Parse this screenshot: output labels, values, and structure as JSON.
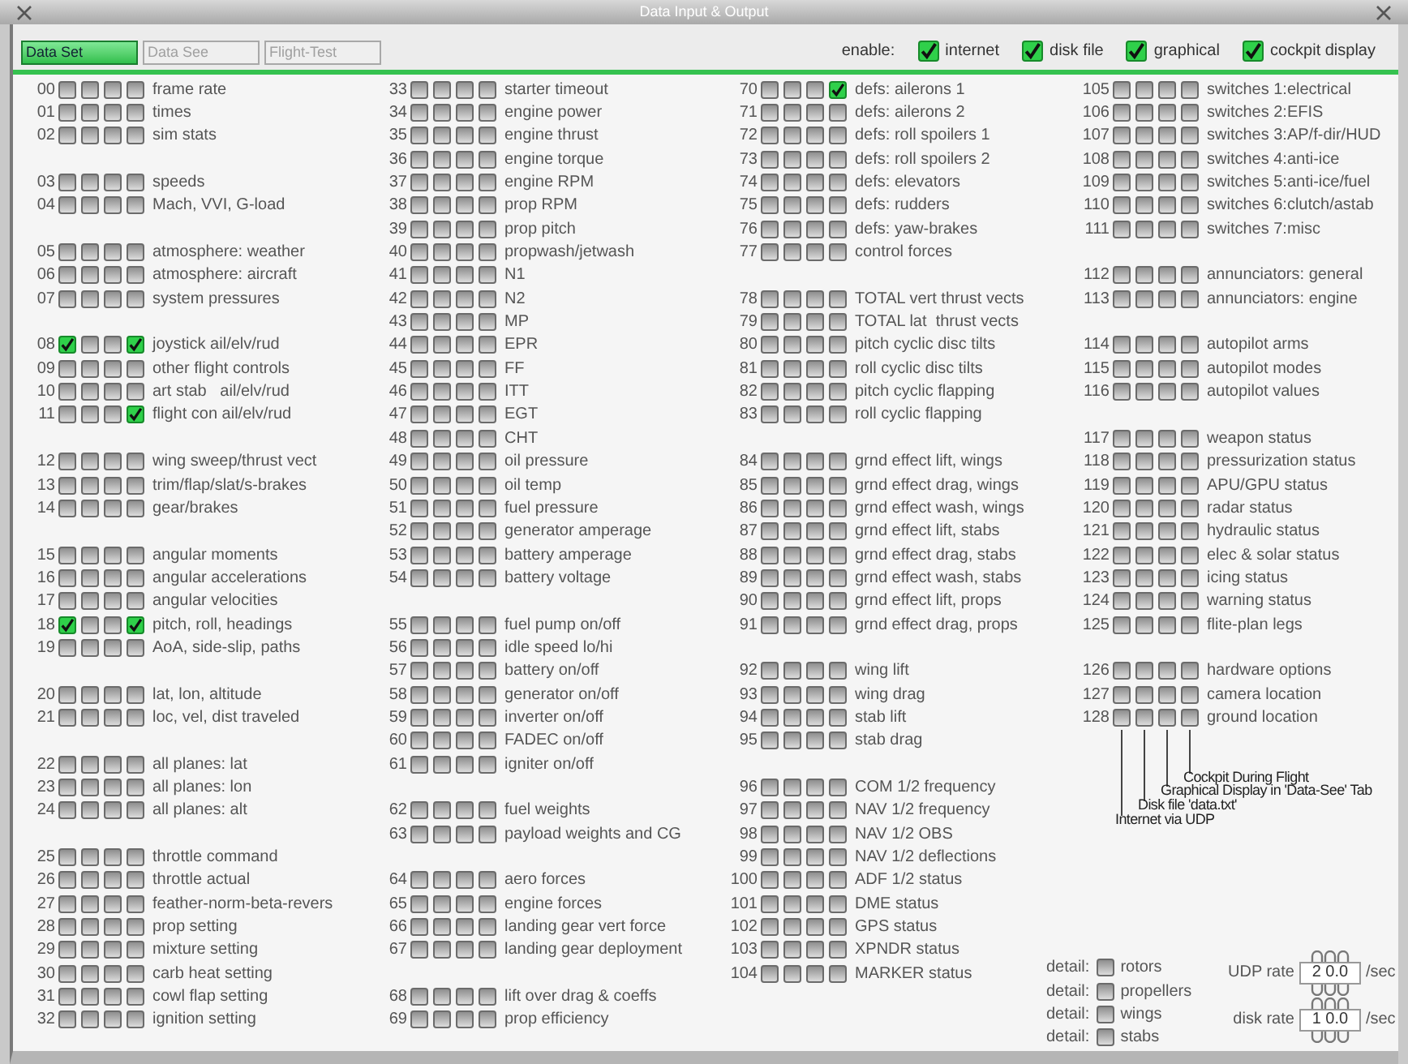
{
  "window": {
    "title": "Data Input & Output"
  },
  "tabs": [
    {
      "label": "Data Set",
      "selected": true
    },
    {
      "label": "Data See",
      "selected": false
    },
    {
      "label": "Flight-Test",
      "selected": false
    }
  ],
  "enable": {
    "label": "enable:",
    "options": [
      {
        "label": "internet",
        "checked": true
      },
      {
        "label": "disk file",
        "checked": true
      },
      {
        "label": "graphical",
        "checked": true
      },
      {
        "label": "cockpit display",
        "checked": true
      }
    ]
  },
  "columns": [
    {
      "groups": [
        [
          {
            "number": "00",
            "label": "frame rate",
            "checks": [
              false,
              false,
              false,
              false
            ]
          },
          {
            "number": "01",
            "label": "times",
            "checks": [
              false,
              false,
              false,
              false
            ]
          },
          {
            "number": "02",
            "label": "sim stats",
            "checks": [
              false,
              false,
              false,
              false
            ]
          }
        ],
        [
          {
            "number": "03",
            "label": "speeds",
            "checks": [
              false,
              false,
              false,
              false
            ]
          },
          {
            "number": "04",
            "label": "Mach, VVI, G-load",
            "checks": [
              false,
              false,
              false,
              false
            ]
          }
        ],
        [
          {
            "number": "05",
            "label": "atmosphere: weather",
            "checks": [
              false,
              false,
              false,
              false
            ]
          },
          {
            "number": "06",
            "label": "atmosphere: aircraft",
            "checks": [
              false,
              false,
              false,
              false
            ]
          },
          {
            "number": "07",
            "label": "system pressures",
            "checks": [
              false,
              false,
              false,
              false
            ]
          }
        ],
        [
          {
            "number": "08",
            "label": "joystick ail/elv/rud",
            "checks": [
              true,
              false,
              false,
              true
            ]
          },
          {
            "number": "09",
            "label": "other flight controls",
            "checks": [
              false,
              false,
              false,
              false
            ]
          },
          {
            "number": "10",
            "label": "art stab   ail/elv/rud",
            "checks": [
              false,
              false,
              false,
              false
            ]
          },
          {
            "number": "11",
            "label": "flight con ail/elv/rud",
            "checks": [
              false,
              false,
              false,
              true
            ]
          }
        ],
        [
          {
            "number": "12",
            "label": "wing sweep/thrust vect",
            "checks": [
              false,
              false,
              false,
              false
            ]
          },
          {
            "number": "13",
            "label": "trim/flap/slat/s-brakes",
            "checks": [
              false,
              false,
              false,
              false
            ]
          },
          {
            "number": "14",
            "label": "gear/brakes",
            "checks": [
              false,
              false,
              false,
              false
            ]
          }
        ],
        [
          {
            "number": "15",
            "label": "angular moments",
            "checks": [
              false,
              false,
              false,
              false
            ]
          },
          {
            "number": "16",
            "label": "angular accelerations",
            "checks": [
              false,
              false,
              false,
              false
            ]
          },
          {
            "number": "17",
            "label": "angular velocities",
            "checks": [
              false,
              false,
              false,
              false
            ]
          },
          {
            "number": "18",
            "label": "pitch, roll, headings",
            "checks": [
              true,
              false,
              false,
              true
            ]
          },
          {
            "number": "19",
            "label": "AoA, side-slip, paths",
            "checks": [
              false,
              false,
              false,
              false
            ]
          }
        ],
        [
          {
            "number": "20",
            "label": "lat, lon, altitude",
            "checks": [
              false,
              false,
              false,
              false
            ]
          },
          {
            "number": "21",
            "label": "loc, vel, dist traveled",
            "checks": [
              false,
              false,
              false,
              false
            ]
          }
        ],
        [
          {
            "number": "22",
            "label": "all planes: lat",
            "checks": [
              false,
              false,
              false,
              false
            ]
          },
          {
            "number": "23",
            "label": "all planes: lon",
            "checks": [
              false,
              false,
              false,
              false
            ]
          },
          {
            "number": "24",
            "label": "all planes: alt",
            "checks": [
              false,
              false,
              false,
              false
            ]
          }
        ],
        [
          {
            "number": "25",
            "label": "throttle command",
            "checks": [
              false,
              false,
              false,
              false
            ]
          },
          {
            "number": "26",
            "label": "throttle actual",
            "checks": [
              false,
              false,
              false,
              false
            ]
          },
          {
            "number": "27",
            "label": "feather-norm-beta-revers",
            "checks": [
              false,
              false,
              false,
              false
            ]
          },
          {
            "number": "28",
            "label": "prop setting",
            "checks": [
              false,
              false,
              false,
              false
            ]
          },
          {
            "number": "29",
            "label": "mixture setting",
            "checks": [
              false,
              false,
              false,
              false
            ]
          },
          {
            "number": "30",
            "label": "carb heat setting",
            "checks": [
              false,
              false,
              false,
              false
            ]
          },
          {
            "number": "31",
            "label": "cowl flap setting",
            "checks": [
              false,
              false,
              false,
              false
            ]
          },
          {
            "number": "32",
            "label": "ignition setting",
            "checks": [
              false,
              false,
              false,
              false
            ]
          }
        ]
      ]
    },
    {
      "groups": [
        [
          {
            "number": "33",
            "label": "starter timeout",
            "checks": [
              false,
              false,
              false,
              false
            ]
          },
          {
            "number": "34",
            "label": "engine power",
            "checks": [
              false,
              false,
              false,
              false
            ]
          },
          {
            "number": "35",
            "label": "engine thrust",
            "checks": [
              false,
              false,
              false,
              false
            ]
          },
          {
            "number": "36",
            "label": "engine torque",
            "checks": [
              false,
              false,
              false,
              false
            ]
          },
          {
            "number": "37",
            "label": "engine RPM",
            "checks": [
              false,
              false,
              false,
              false
            ]
          },
          {
            "number": "38",
            "label": "prop RPM",
            "checks": [
              false,
              false,
              false,
              false
            ]
          },
          {
            "number": "39",
            "label": "prop pitch",
            "checks": [
              false,
              false,
              false,
              false
            ]
          },
          {
            "number": "40",
            "label": "propwash/jetwash",
            "checks": [
              false,
              false,
              false,
              false
            ]
          },
          {
            "number": "41",
            "label": "N1",
            "checks": [
              false,
              false,
              false,
              false
            ]
          },
          {
            "number": "42",
            "label": "N2",
            "checks": [
              false,
              false,
              false,
              false
            ]
          },
          {
            "number": "43",
            "label": "MP",
            "checks": [
              false,
              false,
              false,
              false
            ]
          },
          {
            "number": "44",
            "label": "EPR",
            "checks": [
              false,
              false,
              false,
              false
            ]
          },
          {
            "number": "45",
            "label": "FF",
            "checks": [
              false,
              false,
              false,
              false
            ]
          },
          {
            "number": "46",
            "label": "ITT",
            "checks": [
              false,
              false,
              false,
              false
            ]
          },
          {
            "number": "47",
            "label": "EGT",
            "checks": [
              false,
              false,
              false,
              false
            ]
          },
          {
            "number": "48",
            "label": "CHT",
            "checks": [
              false,
              false,
              false,
              false
            ]
          },
          {
            "number": "49",
            "label": "oil pressure",
            "checks": [
              false,
              false,
              false,
              false
            ]
          },
          {
            "number": "50",
            "label": "oil temp",
            "checks": [
              false,
              false,
              false,
              false
            ]
          },
          {
            "number": "51",
            "label": "fuel pressure",
            "checks": [
              false,
              false,
              false,
              false
            ]
          },
          {
            "number": "52",
            "label": "generator amperage",
            "checks": [
              false,
              false,
              false,
              false
            ]
          },
          {
            "number": "53",
            "label": "battery amperage",
            "checks": [
              false,
              false,
              false,
              false
            ]
          },
          {
            "number": "54",
            "label": "battery voltage",
            "checks": [
              false,
              false,
              false,
              false
            ]
          }
        ],
        [
          {
            "number": "55",
            "label": "fuel pump on/off",
            "checks": [
              false,
              false,
              false,
              false
            ]
          },
          {
            "number": "56",
            "label": "idle speed lo/hi",
            "checks": [
              false,
              false,
              false,
              false
            ]
          },
          {
            "number": "57",
            "label": "battery on/off",
            "checks": [
              false,
              false,
              false,
              false
            ]
          },
          {
            "number": "58",
            "label": "generator on/off",
            "checks": [
              false,
              false,
              false,
              false
            ]
          },
          {
            "number": "59",
            "label": "inverter on/off",
            "checks": [
              false,
              false,
              false,
              false
            ]
          },
          {
            "number": "60",
            "label": "FADEC on/off",
            "checks": [
              false,
              false,
              false,
              false
            ]
          },
          {
            "number": "61",
            "label": "igniter on/off",
            "checks": [
              false,
              false,
              false,
              false
            ]
          }
        ],
        [
          {
            "number": "62",
            "label": "fuel weights",
            "checks": [
              false,
              false,
              false,
              false
            ]
          },
          {
            "number": "63",
            "label": "payload weights and CG",
            "checks": [
              false,
              false,
              false,
              false
            ]
          }
        ],
        [
          {
            "number": "64",
            "label": "aero forces",
            "checks": [
              false,
              false,
              false,
              false
            ]
          },
          {
            "number": "65",
            "label": "engine forces",
            "checks": [
              false,
              false,
              false,
              false
            ]
          },
          {
            "number": "66",
            "label": "landing gear vert force",
            "checks": [
              false,
              false,
              false,
              false
            ]
          },
          {
            "number": "67",
            "label": "landing gear deployment",
            "checks": [
              false,
              false,
              false,
              false
            ]
          }
        ],
        [
          {
            "number": "68",
            "label": "lift over drag & coeffs",
            "checks": [
              false,
              false,
              false,
              false
            ]
          },
          {
            "number": "69",
            "label": "prop efficiency",
            "checks": [
              false,
              false,
              false,
              false
            ]
          }
        ]
      ]
    },
    {
      "groups": [
        [
          {
            "number": "70",
            "label": "defs: ailerons 1",
            "checks": [
              false,
              false,
              false,
              true
            ]
          },
          {
            "number": "71",
            "label": "defs: ailerons 2",
            "checks": [
              false,
              false,
              false,
              false
            ]
          },
          {
            "number": "72",
            "label": "defs: roll spoilers 1",
            "checks": [
              false,
              false,
              false,
              false
            ]
          },
          {
            "number": "73",
            "label": "defs: roll spoilers 2",
            "checks": [
              false,
              false,
              false,
              false
            ]
          },
          {
            "number": "74",
            "label": "defs: elevators",
            "checks": [
              false,
              false,
              false,
              false
            ]
          },
          {
            "number": "75",
            "label": "defs: rudders",
            "checks": [
              false,
              false,
              false,
              false
            ]
          },
          {
            "number": "76",
            "label": "defs: yaw-brakes",
            "checks": [
              false,
              false,
              false,
              false
            ]
          },
          {
            "number": "77",
            "label": "control forces",
            "checks": [
              false,
              false,
              false,
              false
            ]
          }
        ],
        [
          {
            "number": "78",
            "label": "TOTAL vert thrust vects",
            "checks": [
              false,
              false,
              false,
              false
            ]
          },
          {
            "number": "79",
            "label": "TOTAL lat  thrust vects",
            "checks": [
              false,
              false,
              false,
              false
            ]
          },
          {
            "number": "80",
            "label": "pitch cyclic disc tilts",
            "checks": [
              false,
              false,
              false,
              false
            ]
          },
          {
            "number": "81",
            "label": "roll cyclic disc tilts",
            "checks": [
              false,
              false,
              false,
              false
            ]
          },
          {
            "number": "82",
            "label": "pitch cyclic flapping",
            "checks": [
              false,
              false,
              false,
              false
            ]
          },
          {
            "number": "83",
            "label": "roll cyclic flapping",
            "checks": [
              false,
              false,
              false,
              false
            ]
          }
        ],
        [
          {
            "number": "84",
            "label": "grnd effect lift, wings",
            "checks": [
              false,
              false,
              false,
              false
            ]
          },
          {
            "number": "85",
            "label": "grnd effect drag, wings",
            "checks": [
              false,
              false,
              false,
              false
            ]
          },
          {
            "number": "86",
            "label": "grnd effect wash, wings",
            "checks": [
              false,
              false,
              false,
              false
            ]
          },
          {
            "number": "87",
            "label": "grnd effect lift, stabs",
            "checks": [
              false,
              false,
              false,
              false
            ]
          },
          {
            "number": "88",
            "label": "grnd effect drag, stabs",
            "checks": [
              false,
              false,
              false,
              false
            ]
          },
          {
            "number": "89",
            "label": "grnd effect wash, stabs",
            "checks": [
              false,
              false,
              false,
              false
            ]
          },
          {
            "number": "90",
            "label": "grnd effect lift, props",
            "checks": [
              false,
              false,
              false,
              false
            ]
          },
          {
            "number": "91",
            "label": "grnd effect drag, props",
            "checks": [
              false,
              false,
              false,
              false
            ]
          }
        ],
        [
          {
            "number": "92",
            "label": "wing lift",
            "checks": [
              false,
              false,
              false,
              false
            ]
          },
          {
            "number": "93",
            "label": "wing drag",
            "checks": [
              false,
              false,
              false,
              false
            ]
          },
          {
            "number": "94",
            "label": "stab lift",
            "checks": [
              false,
              false,
              false,
              false
            ]
          },
          {
            "number": "95",
            "label": "stab drag",
            "checks": [
              false,
              false,
              false,
              false
            ]
          }
        ],
        [
          {
            "number": "96",
            "label": "COM 1/2 frequency",
            "checks": [
              false,
              false,
              false,
              false
            ]
          },
          {
            "number": "97",
            "label": "NAV 1/2 frequency",
            "checks": [
              false,
              false,
              false,
              false
            ]
          },
          {
            "number": "98",
            "label": "NAV 1/2 OBS",
            "checks": [
              false,
              false,
              false,
              false
            ]
          },
          {
            "number": "99",
            "label": "NAV 1/2 deflections",
            "checks": [
              false,
              false,
              false,
              false
            ]
          },
          {
            "number": "100",
            "label": "ADF 1/2 status",
            "checks": [
              false,
              false,
              false,
              false
            ]
          },
          {
            "number": "101",
            "label": "DME status",
            "checks": [
              false,
              false,
              false,
              false
            ]
          },
          {
            "number": "102",
            "label": "GPS status",
            "checks": [
              false,
              false,
              false,
              false
            ]
          },
          {
            "number": "103",
            "label": "XPNDR status",
            "checks": [
              false,
              false,
              false,
              false
            ]
          },
          {
            "number": "104",
            "label": "MARKER status",
            "checks": [
              false,
              false,
              false,
              false
            ]
          }
        ]
      ]
    },
    {
      "groups": [
        [
          {
            "number": "105",
            "label": "switches 1:electrical",
            "checks": [
              false,
              false,
              false,
              false
            ]
          },
          {
            "number": "106",
            "label": "switches 2:EFIS",
            "checks": [
              false,
              false,
              false,
              false
            ]
          },
          {
            "number": "107",
            "label": "switches 3:AP/f-dir/HUD",
            "checks": [
              false,
              false,
              false,
              false
            ]
          },
          {
            "number": "108",
            "label": "switches 4:anti-ice",
            "checks": [
              false,
              false,
              false,
              false
            ]
          },
          {
            "number": "109",
            "label": "switches 5:anti-ice/fuel",
            "checks": [
              false,
              false,
              false,
              false
            ]
          },
          {
            "number": "110",
            "label": "switches 6:clutch/astab",
            "checks": [
              false,
              false,
              false,
              false
            ]
          },
          {
            "number": "111",
            "label": "switches 7:misc",
            "checks": [
              false,
              false,
              false,
              false
            ]
          }
        ],
        [
          {
            "number": "112",
            "label": "annunciators: general",
            "checks": [
              false,
              false,
              false,
              false
            ]
          },
          {
            "number": "113",
            "label": "annunciators: engine",
            "checks": [
              false,
              false,
              false,
              false
            ]
          }
        ],
        [
          {
            "number": "114",
            "label": "autopilot arms",
            "checks": [
              false,
              false,
              false,
              false
            ]
          },
          {
            "number": "115",
            "label": "autopilot modes",
            "checks": [
              false,
              false,
              false,
              false
            ]
          },
          {
            "number": "116",
            "label": "autopilot values",
            "checks": [
              false,
              false,
              false,
              false
            ]
          }
        ],
        [
          {
            "number": "117",
            "label": "weapon status",
            "checks": [
              false,
              false,
              false,
              false
            ]
          },
          {
            "number": "118",
            "label": "pressurization status",
            "checks": [
              false,
              false,
              false,
              false
            ]
          },
          {
            "number": "119",
            "label": "APU/GPU status",
            "checks": [
              false,
              false,
              false,
              false
            ]
          },
          {
            "number": "120",
            "label": "radar status",
            "checks": [
              false,
              false,
              false,
              false
            ]
          },
          {
            "number": "121",
            "label": "hydraulic status",
            "checks": [
              false,
              false,
              false,
              false
            ]
          },
          {
            "number": "122",
            "label": "elec & solar status",
            "checks": [
              false,
              false,
              false,
              false
            ]
          },
          {
            "number": "123",
            "label": "icing status",
            "checks": [
              false,
              false,
              false,
              false
            ]
          },
          {
            "number": "124",
            "label": "warning status",
            "checks": [
              false,
              false,
              false,
              false
            ]
          },
          {
            "number": "125",
            "label": "flite-plan legs",
            "checks": [
              false,
              false,
              false,
              false
            ]
          }
        ],
        [
          {
            "number": "126",
            "label": "hardware options",
            "checks": [
              false,
              false,
              false,
              false
            ]
          },
          {
            "number": "127",
            "label": "camera location",
            "checks": [
              false,
              false,
              false,
              false
            ]
          },
          {
            "number": "128",
            "label": "ground location",
            "checks": [
              false,
              false,
              false,
              false
            ]
          }
        ]
      ]
    }
  ],
  "legend": [
    "Cockpit During Flight",
    "Graphical Display in 'Data-See' Tab",
    "Disk file 'data.txt'",
    "Internet via UDP"
  ],
  "details": [
    {
      "label": "detail:",
      "name": "rotors",
      "checked": false
    },
    {
      "label": "detail:",
      "name": "propellers",
      "checked": false
    },
    {
      "label": "detail:",
      "name": "wings",
      "checked": false
    },
    {
      "label": "detail:",
      "name": "stabs",
      "checked": false
    }
  ],
  "rates": [
    {
      "label": "UDP rate",
      "value": "2 0.0",
      "unit": "/sec"
    },
    {
      "label": "disk rate",
      "value": "1 0.0",
      "unit": "/sec"
    }
  ]
}
